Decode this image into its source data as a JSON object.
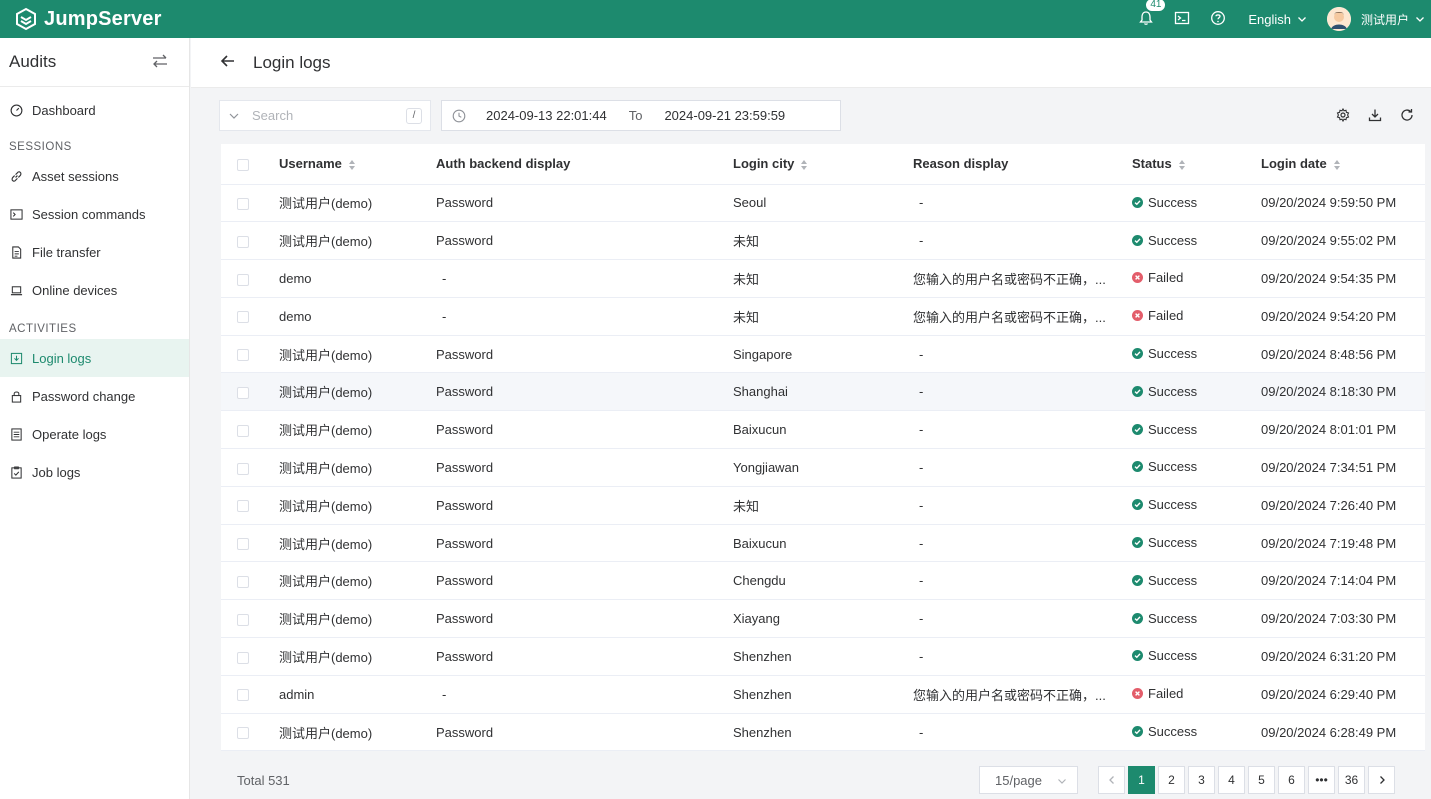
{
  "brand": {
    "name": "JumpServer"
  },
  "topbar": {
    "notification_count": "41",
    "language": "English",
    "user_name": "测试用户"
  },
  "sidebar": {
    "title": "Audits",
    "dashboard": "Dashboard",
    "groups": [
      {
        "label": "SESSIONS",
        "items": [
          "Asset sessions",
          "Session commands",
          "File transfer",
          "Online devices"
        ]
      },
      {
        "label": "ACTIVITIES",
        "items": [
          "Login logs",
          "Password change",
          "Operate logs",
          "Job logs"
        ]
      }
    ],
    "active": "Login logs"
  },
  "page": {
    "title": "Login logs"
  },
  "toolbar": {
    "search_placeholder": "Search",
    "search_shortcut": "/",
    "date_from": "2024-09-13 22:01:44",
    "date_to_label": "To",
    "date_to": "2024-09-21 23:59:59"
  },
  "table": {
    "columns": [
      "Username",
      "Auth backend display",
      "Login city",
      "Reason display",
      "Status",
      "Login date"
    ],
    "rows": [
      [
        "测试用户(demo)",
        "Password",
        "Seoul",
        "-",
        "Success",
        "09/20/2024 9:59:50 PM"
      ],
      [
        "测试用户(demo)",
        "Password",
        "未知",
        "-",
        "Success",
        "09/20/2024 9:55:02 PM"
      ],
      [
        "demo",
        "-",
        "未知",
        "您输入的用户名或密码不正确，...",
        "Failed",
        "09/20/2024 9:54:35 PM"
      ],
      [
        "demo",
        "-",
        "未知",
        "您输入的用户名或密码不正确，...",
        "Failed",
        "09/20/2024 9:54:20 PM"
      ],
      [
        "测试用户(demo)",
        "Password",
        "Singapore",
        "-",
        "Success",
        "09/20/2024 8:48:56 PM"
      ],
      [
        "测试用户(demo)",
        "Password",
        "Shanghai",
        "-",
        "Success",
        "09/20/2024 8:18:30 PM"
      ],
      [
        "测试用户(demo)",
        "Password",
        "Baixucun",
        "-",
        "Success",
        "09/20/2024 8:01:01 PM"
      ],
      [
        "测试用户(demo)",
        "Password",
        "Yongjiawan",
        "-",
        "Success",
        "09/20/2024 7:34:51 PM"
      ],
      [
        "测试用户(demo)",
        "Password",
        "未知",
        "-",
        "Success",
        "09/20/2024 7:26:40 PM"
      ],
      [
        "测试用户(demo)",
        "Password",
        "Baixucun",
        "-",
        "Success",
        "09/20/2024 7:19:48 PM"
      ],
      [
        "测试用户(demo)",
        "Password",
        "Chengdu",
        "-",
        "Success",
        "09/20/2024 7:14:04 PM"
      ],
      [
        "测试用户(demo)",
        "Password",
        "Xiayang",
        "-",
        "Success",
        "09/20/2024 7:03:30 PM"
      ],
      [
        "测试用户(demo)",
        "Password",
        "Shenzhen",
        "-",
        "Success",
        "09/20/2024 6:31:20 PM"
      ],
      [
        "admin",
        "-",
        "Shenzhen",
        "您输入的用户名或密码不正确，...",
        "Failed",
        "09/20/2024 6:29:40 PM"
      ],
      [
        "测试用户(demo)",
        "Password",
        "Shenzhen",
        "-",
        "Success",
        "09/20/2024 6:28:49 PM"
      ]
    ],
    "hovered_row": 5
  },
  "footer": {
    "total": "Total 531",
    "page_size": "15/page",
    "pages": [
      "1",
      "2",
      "3",
      "4",
      "5",
      "6",
      "•••",
      "36"
    ],
    "current_page": "1"
  },
  "colors": {
    "brand": "#1d8a6e",
    "success": "#1d8a6e",
    "failed": "#e35d6a"
  }
}
